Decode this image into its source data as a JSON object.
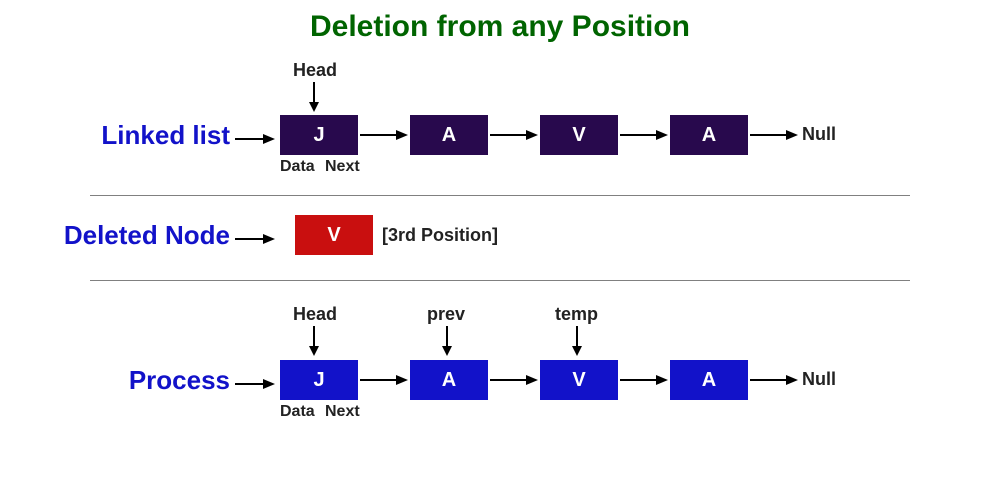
{
  "title": "Deletion from any Position",
  "row1": {
    "label": "Linked list",
    "head_label": "Head",
    "nodes": [
      "J",
      "A",
      "V",
      "A"
    ],
    "null_label": "Null",
    "sub_data": "Data",
    "sub_next": "Next"
  },
  "row2": {
    "label": "Deleted Node",
    "node": "V",
    "position_note": "[3rd Position]"
  },
  "row3": {
    "label": "Process",
    "head_label": "Head",
    "prev_label": "prev",
    "temp_label": "temp",
    "nodes": [
      "J",
      "A",
      "V",
      "A"
    ],
    "null_label": "Null",
    "sub_data": "Data",
    "sub_next": "Next"
  }
}
